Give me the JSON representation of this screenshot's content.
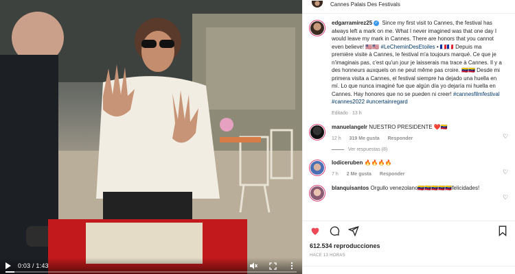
{
  "post": {
    "location": "Cannes Palais Des Festivals"
  },
  "caption": {
    "username": "edgarramirez25",
    "text_before_tag": " Since my first visit to Cannes, the festival has always left a mark on me. What I never imagined was that one day I would leave my mark in Cannes. There are honors that you cannot even believe! 🇺🇸🇺🇸 ",
    "tag": "#LeCheminDesEtoiles",
    "text_after_tag": " • 🇫🇷🇫🇷 Depuis ma première visite à Cannes, le festival m'a toujours marqué. Ce que je n'imaginais pas, c'est qu'un jour je laisserais ma trace à Cannes. Il y a des honneurs auxquels on ne peut même pas croire. 🇻🇪🇻🇪 Desde mi primera visita a Cannes, el festival siempre ha dejado una huella en mí. Lo que nunca imaginé fue que algún día yo dejaría mi huella en Cannes. Hay honores que no se pueden ni creer! ",
    "hashtags": "#cannesfilmfestival #cannes2022 #uncertainregard",
    "edited": "Editado · 13 h"
  },
  "comments": [
    {
      "username": "manuelangelr",
      "text": " NUESTRO PRESIDENTE ❤️🇻🇪",
      "time": "12 h",
      "likes": "319 Me gusta",
      "reply": "Responder",
      "view_replies": "Ver respuestas (8)"
    },
    {
      "username": "lodiceruben",
      "text": " 🔥🔥🔥🔥",
      "time": "7 h",
      "likes": "2 Me gusta",
      "reply": "Responder"
    },
    {
      "username": "blanquisantos",
      "text": " Orgullo venezolano🇻🇪🇻🇪🇻🇪🇻🇪🇻🇪felicidades!"
    }
  ],
  "actions": {
    "like_icon": "heart-filled-icon",
    "comment_icon": "comment-icon",
    "share_icon": "send-icon",
    "save_icon": "bookmark-icon"
  },
  "stats": {
    "views": "612.534 reproducciones",
    "ago": "HACE 13 HORAS"
  },
  "video": {
    "time": "0:03 / 1:43",
    "progress": 0.03,
    "icons": [
      "play-icon",
      "mute-icon",
      "fullscreen-icon",
      "more-icon"
    ]
  },
  "colors": {
    "like": "#ed4956",
    "link": "#00376b",
    "verified": "#3897f0",
    "muted": "#8e8e8e"
  }
}
